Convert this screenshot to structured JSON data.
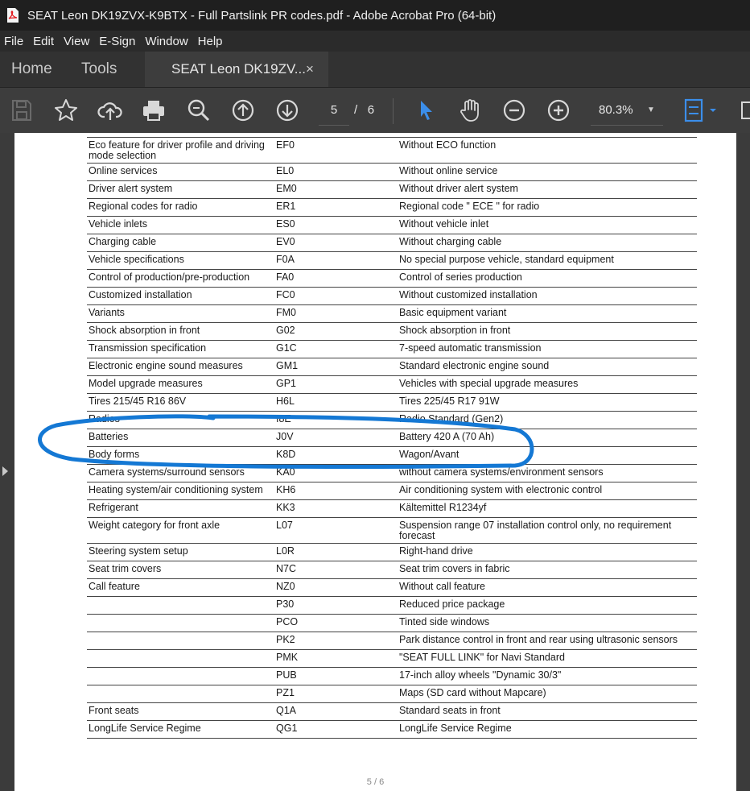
{
  "window": {
    "title": "SEAT Leon DK19ZVX-K9BTX - Full Partslink PR codes.pdf - Adobe Acrobat Pro (64-bit)"
  },
  "menu": [
    "File",
    "Edit",
    "View",
    "E-Sign",
    "Window",
    "Help"
  ],
  "tabs": {
    "home": "Home",
    "tools": "Tools",
    "document": "SEAT Leon DK19ZV...",
    "close": "×"
  },
  "toolbar": {
    "current_page": "5",
    "page_separator": "/",
    "total_pages": "6",
    "zoom": "80.3%",
    "icons": [
      "save-icon",
      "bookmark-star-icon",
      "upload-cloud-icon",
      "print-icon",
      "zoom-search-icon",
      "page-up-icon",
      "page-down-icon",
      "select-cursor-icon",
      "hand-tool-icon",
      "zoom-out-icon",
      "zoom-in-icon",
      "page-fit-icon"
    ]
  },
  "document": {
    "rows": [
      [
        "Eco feature for driver profile and driving mode selection",
        "EF0",
        "Without ECO function"
      ],
      [
        "Online services",
        "EL0",
        "Without online service"
      ],
      [
        "Driver alert system",
        "EM0",
        "Without driver alert system"
      ],
      [
        "Regional codes for radio",
        "ER1",
        "Regional code \" ECE \" for radio"
      ],
      [
        "Vehicle inlets",
        "ES0",
        "Without vehicle inlet"
      ],
      [
        "Charging cable",
        "EV0",
        "Without charging cable"
      ],
      [
        "Vehicle specifications",
        "F0A",
        "No special purpose vehicle, standard  equipment"
      ],
      [
        "Control of production/pre-production",
        "FA0",
        "Control of series production"
      ],
      [
        "Customized installation",
        "FC0",
        "Without customized installation"
      ],
      [
        "Variants",
        "FM0",
        "Basic equipment variant"
      ],
      [
        "Shock absorption in front",
        "G02",
        "Shock absorption in front"
      ],
      [
        "Transmission specification",
        "G1C",
        "7-speed automatic transmission"
      ],
      [
        "Electronic engine sound measures",
        "GM1",
        "Standard electronic engine sound"
      ],
      [
        "Model upgrade measures",
        "GP1",
        "Vehicles with special upgrade measures"
      ],
      [
        "Tires 215/45 R16 86V",
        "H6L",
        "Tires 225/45 R17 91W"
      ],
      [
        "Radios",
        "I8E",
        "Radio Standard (Gen2)"
      ],
      [
        "Batteries",
        "J0V",
        "Battery 420 A (70 Ah)"
      ],
      [
        "Body forms",
        "K8D",
        "Wagon/Avant"
      ],
      [
        "Camera systems/surround sensors",
        "KA0",
        "without camera systems/environment sensors"
      ],
      [
        "Heating system/air conditioning system",
        "KH6",
        "Air conditioning system with electronic control"
      ],
      [
        "Refrigerant",
        "KK3",
        "Kältemittel R1234yf"
      ],
      [
        "Weight category for front axle",
        "L07",
        "Suspension range 07  installation control only, no  requirement forecast"
      ],
      [
        "Steering system setup",
        "L0R",
        "Right-hand drive"
      ],
      [
        "Seat trim covers",
        "N7C",
        "Seat trim covers in fabric"
      ],
      [
        "Call feature",
        "NZ0",
        "Without call feature"
      ],
      [
        "",
        "P30",
        "Reduced price package"
      ],
      [
        "",
        "PCO",
        "Tinted side windows"
      ],
      [
        "",
        "PK2",
        "Park distance control in front and rear  using ultrasonic sensors"
      ],
      [
        "",
        "PMK",
        "\"SEAT FULL LINK\"  for Navi Standard"
      ],
      [
        "",
        "PUB",
        "17-inch alloy wheels \"Dynamic 30/3\""
      ],
      [
        "",
        "PZ1",
        "Maps (SD card without Mapcare)"
      ],
      [
        "Front seats",
        "Q1A",
        "Standard seats in front"
      ],
      [
        "LongLife Service Regime",
        "QG1",
        "LongLife Service Regime"
      ]
    ],
    "footer_page": "5 / 6"
  },
  "colors": {
    "annotation": "#1478d4",
    "accent_blue": "#3b8eea"
  }
}
